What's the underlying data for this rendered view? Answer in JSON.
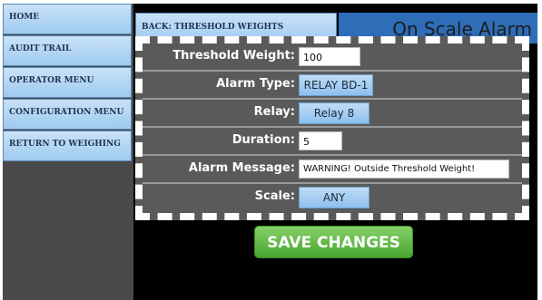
{
  "sidebar": {
    "items": [
      {
        "label": "HOME"
      },
      {
        "label": "AUDIT TRAIL"
      },
      {
        "label": "OPERATOR MENU"
      },
      {
        "label": "CONFIGURATION MENU"
      },
      {
        "label": "RETURN TO WEIGHING"
      }
    ]
  },
  "header": {
    "back_label": "BACK: THRESHOLD WEIGHTS",
    "alarm_title": "On Scale Alarm"
  },
  "form": {
    "threshold_weight": {
      "label": "Threshold Weight:",
      "value": "100"
    },
    "alarm_type": {
      "label": "Alarm Type:",
      "value": "RELAY BD-1"
    },
    "relay": {
      "label": "Relay:",
      "value": "Relay 8"
    },
    "duration": {
      "label": "Duration:",
      "value": "5"
    },
    "alarm_message": {
      "label": "Alarm Message:",
      "value": "WARNING! Outside Threshold Weight!"
    },
    "scale": {
      "label": "Scale:",
      "value": "ANY"
    }
  },
  "actions": {
    "save_label": "SAVE CHANGES"
  },
  "colors": {
    "nav_button": "#9fcaf0",
    "alarm_banner": "#2e6db8",
    "save_button": "#48a52e",
    "panel": "#5a5a5a"
  }
}
